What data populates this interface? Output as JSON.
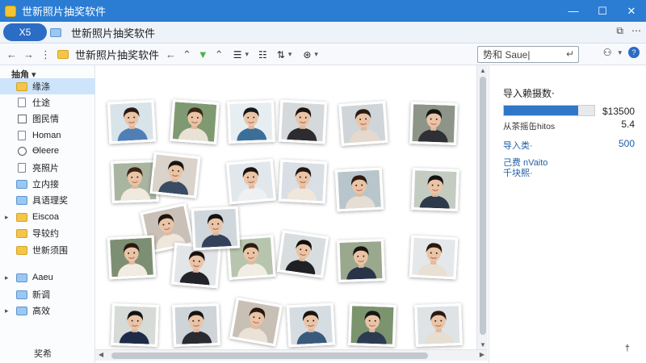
{
  "window": {
    "title": "世新照片抽奖软件",
    "controls": {
      "minimize": "—",
      "maximize": "☐",
      "close": "✕"
    }
  },
  "tabbar": {
    "pill_label": "X5",
    "tab_title": "世新照片抽奖软件",
    "right_icons": [
      "⧉",
      "⋯"
    ]
  },
  "toolbar": {
    "path": "世新照片抽奖软件",
    "search_placeholder": "势和 Saue|",
    "search_icon_glyph": "↵",
    "view_glyphs": [
      "☰",
      "☷",
      "⇅",
      "⊛"
    ]
  },
  "sidebar": {
    "header": "抽角 ▾",
    "items": [
      {
        "label": "缘涤",
        "icon": "folder",
        "arrow": "",
        "selected": true
      },
      {
        "label": "仕途",
        "icon": "doc",
        "arrow": ""
      },
      {
        "label": "图民情",
        "icon": "grid",
        "arrow": ""
      },
      {
        "label": "Homan",
        "icon": "doc",
        "arrow": ""
      },
      {
        "label": "Ɵleere",
        "icon": "clock",
        "arrow": ""
      },
      {
        "label": "亮照片",
        "icon": "doc",
        "arrow": ""
      },
      {
        "label": "立内接",
        "icon": "blue",
        "arrow": ""
      },
      {
        "label": "具语理奖",
        "icon": "blue",
        "arrow": ""
      },
      {
        "label": "Eiscoa",
        "icon": "folder",
        "arrow": "▸"
      },
      {
        "label": "导较约",
        "icon": "folder",
        "arrow": ""
      },
      {
        "label": "世新须围",
        "icon": "folder",
        "arrow": ""
      },
      {
        "label": "Aaeu",
        "icon": "blue",
        "arrow": "▸"
      },
      {
        "label": "新调",
        "icon": "blue",
        "arrow": ""
      },
      {
        "label": "高效",
        "icon": "blue",
        "arrow": "▸"
      }
    ],
    "footer": "奖希"
  },
  "panel": {
    "title": "导入赖摄数·",
    "bar_value": "$13500",
    "bar_fill_fraction": 0.82,
    "row1_label": "从茶摇缶hitos",
    "row1_value": "5.4",
    "row2_label": "导入类·",
    "row2_value": "500",
    "row3_label": "己费 nVaito",
    "row4_label": "千块熙·",
    "corner_mark": "†"
  },
  "photos": [
    {
      "name": "photo-1",
      "bg": "#d8e3ea",
      "shirt": "#4f7fb5",
      "hair": "#2a1b12",
      "rot": -3
    },
    {
      "name": "photo-2",
      "bg": "#7f9a72",
      "shirt": "#e8e2d6",
      "hair": "#3a2618",
      "rot": 4
    },
    {
      "name": "photo-3",
      "bg": "#e6eef2",
      "shirt": "#3c6e9a",
      "hair": "#1a1a1a",
      "rot": -2
    },
    {
      "name": "photo-4",
      "bg": "#d6d9db",
      "shirt": "#2b2b30",
      "hair": "#1e140e",
      "rot": 3
    },
    {
      "name": "photo-5",
      "bg": "#cfd5d8",
      "shirt": "#e4d9cc",
      "hair": "#2b1c14",
      "rot": -4
    },
    {
      "name": "photo-6",
      "bg": "#8d9488",
      "shirt": "#2f3035",
      "hair": "#141414",
      "rot": 2
    },
    {
      "name": "photo-7",
      "bg": "#a9b5a1",
      "shirt": "#efe9de",
      "hair": "#3d2414",
      "rot": -2
    },
    {
      "name": "photo-8",
      "bg": "#dad3cb",
      "shirt": "#3a4c63",
      "hair": "#191411",
      "rot": 6
    },
    {
      "name": "photo-9",
      "bg": "#e2e7eb",
      "shirt": "#eef0f2",
      "hair": "#1c1410",
      "rot": -5
    },
    {
      "name": "photo-10",
      "bg": "#d9dfe5",
      "shirt": "#f0e6dc",
      "hair": "#241812",
      "rot": 3
    },
    {
      "name": "photo-11",
      "bg": "#b8c6cc",
      "shirt": "#e5ded5",
      "hair": "#2d1d14",
      "rot": -3
    },
    {
      "name": "photo-12",
      "bg": "#c4ccc2",
      "shirt": "#2d3a4c",
      "hair": "#141414",
      "rot": 2
    },
    {
      "name": "photo-13",
      "bg": "#c9c1b8",
      "shirt": "#efe7dc",
      "hair": "#20140e",
      "rot": -12
    },
    {
      "name": "photo-14",
      "bg": "#7d8f72",
      "shirt": "#f1ece2",
      "hair": "#2a1a10",
      "rot": -3
    },
    {
      "name": "photo-15",
      "bg": "#e3e6e8",
      "shirt": "#23242a",
      "hair": "#1a120d",
      "rot": 5
    },
    {
      "name": "photo-16",
      "bg": "#b7c5ae",
      "shirt": "#f2ede4",
      "hair": "#2c1c12",
      "rot": -4
    },
    {
      "name": "photo-17",
      "bg": "#d8dde0",
      "shirt": "#1f2025",
      "hair": "#120d0a",
      "rot": 8
    },
    {
      "name": "photo-18",
      "bg": "#9aa88e",
      "shirt": "#2a3448",
      "hair": "#1a1410",
      "rot": -2
    },
    {
      "name": "photo-19",
      "bg": "#e4e8eb",
      "shirt": "#e9e0d4",
      "hair": "#281a12",
      "rot": 3
    },
    {
      "name": "photo-20",
      "bg": "#d0d7dc",
      "shirt": "#33425a",
      "hair": "#161210",
      "rot": -3
    },
    {
      "name": "photo-21",
      "bg": "#d6dbd8",
      "shirt": "#1e2b48",
      "hair": "#131313",
      "rot": 2
    },
    {
      "name": "photo-22",
      "bg": "#cfd4d8",
      "shirt": "#2a2b30",
      "hair": "#141414",
      "rot": -2
    },
    {
      "name": "photo-23",
      "bg": "#c8bfb5",
      "shirt": "#eae2d6",
      "hair": "#261910",
      "rot": 10
    },
    {
      "name": "photo-24",
      "bg": "#d6dde2",
      "shirt": "#3a5a7c",
      "hair": "#1b140f",
      "rot": -3
    },
    {
      "name": "photo-25",
      "bg": "#7c946e",
      "shirt": "#2c3a52",
      "hair": "#161616",
      "rot": 2
    },
    {
      "name": "photo-26",
      "bg": "#dfe3e6",
      "shirt": "#e6ded2",
      "hair": "#2a1b12",
      "rot": -2
    }
  ]
}
